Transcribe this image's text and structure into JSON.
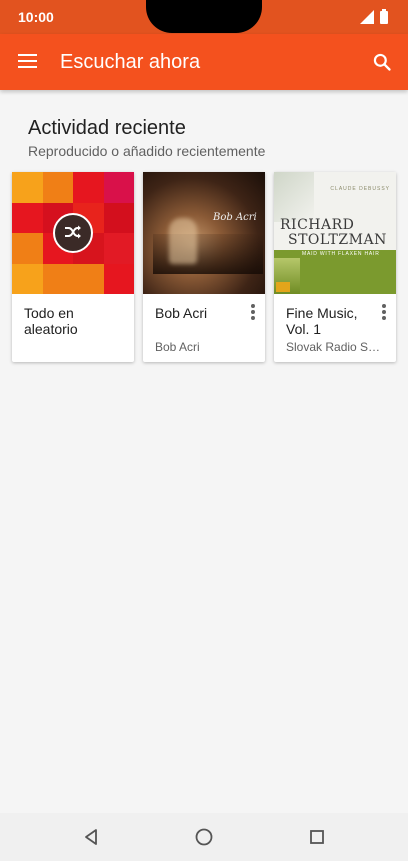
{
  "status_bar": {
    "time": "10:00"
  },
  "app_bar": {
    "title": "Escuchar ahora"
  },
  "section": {
    "title": "Actividad reciente",
    "subtitle": "Reproducido o añadido recientemente"
  },
  "cards": [
    {
      "title": "Todo en aleatorio",
      "subtitle": ""
    },
    {
      "title": "Bob Acri",
      "subtitle": "Bob Acri"
    },
    {
      "title": "Fine Music, Vol. 1",
      "subtitle": "Slovak Radio Symphony Orchestra"
    }
  ],
  "covers": {
    "richard": {
      "composer": "CLAUDE DEBUSSY",
      "name_line1": "RICHARD",
      "name_line2": "STOLTZMAN",
      "subtitle": "MAID WITH FLAXEN HAIR"
    },
    "bob": {
      "script": "Bob Acri"
    }
  },
  "colors": {
    "accent": "#f4511e",
    "status_bar": "#e2531f",
    "background": "#f5f5f5"
  }
}
